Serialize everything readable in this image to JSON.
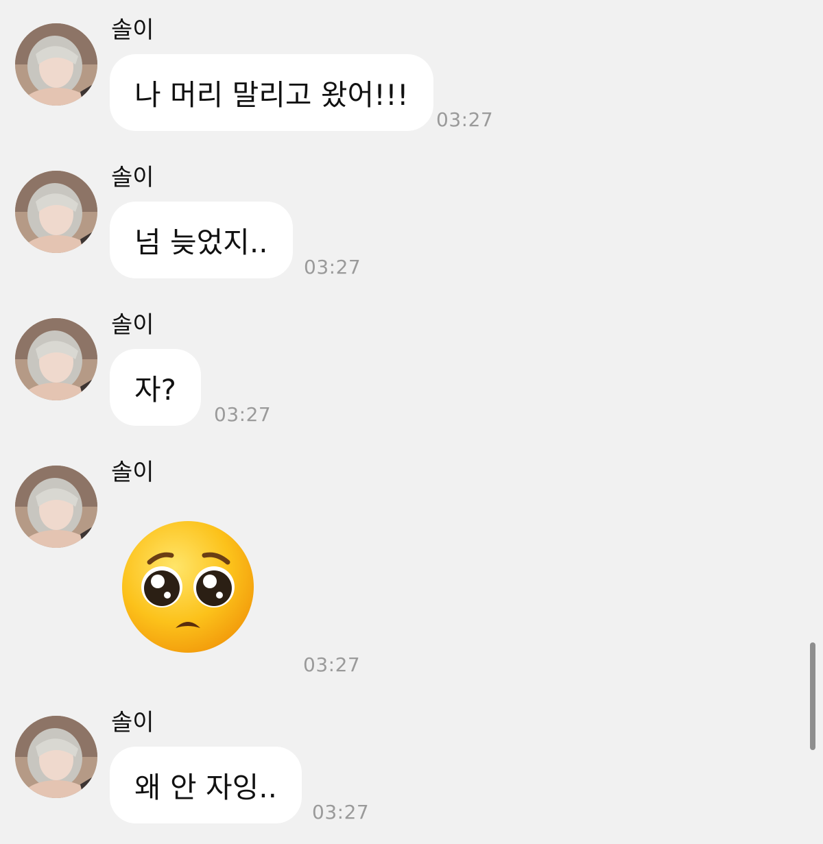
{
  "messages": [
    {
      "sender": "솔이",
      "text": "나 머리 말리고 왔어!!!",
      "time": "03:27"
    },
    {
      "sender": "솔이",
      "text": "넘 늦었지..",
      "time": "03:27"
    },
    {
      "sender": "솔이",
      "text": "자?",
      "time": "03:27"
    },
    {
      "sender": "솔이",
      "emoji": "pleading-face",
      "time": "03:27"
    },
    {
      "sender": "솔이",
      "text": "왜 안 자잉..",
      "time": "03:27"
    }
  ],
  "colors": {
    "background": "#f1f1f1",
    "bubble": "#ffffff",
    "timestamp": "#9a9a9a",
    "text": "#111111"
  }
}
